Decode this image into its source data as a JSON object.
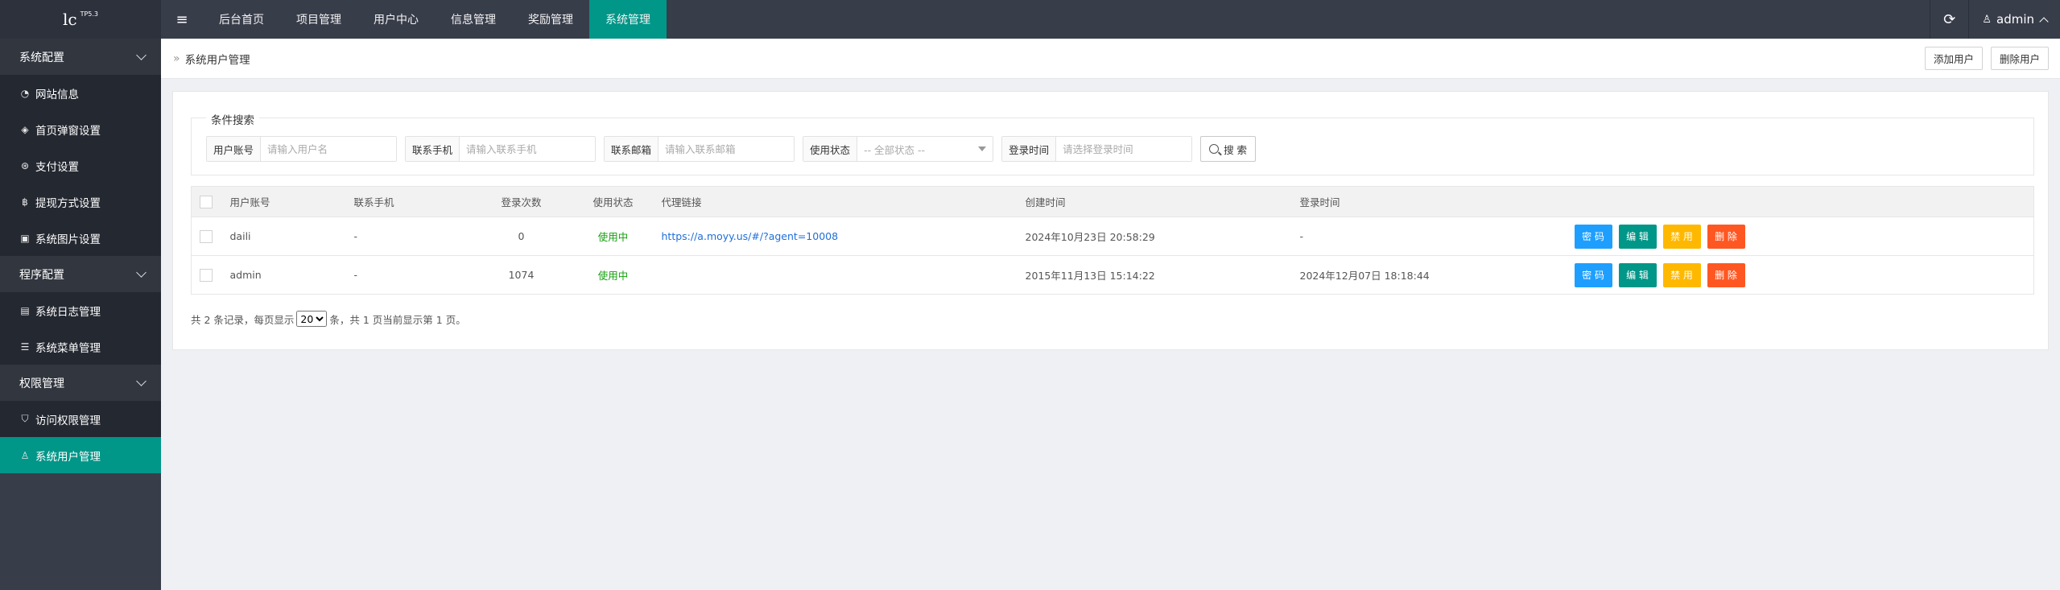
{
  "logo": {
    "text": "lc",
    "version": "TP5.3"
  },
  "sidebar": {
    "sections": [
      {
        "label": "系统配置",
        "items": [
          {
            "label": "网站信息",
            "icon": "gauge-icon"
          },
          {
            "label": "首页弹窗设置",
            "icon": "tag-icon"
          },
          {
            "label": "支付设置",
            "icon": "payment-icon"
          },
          {
            "label": "提现方式设置",
            "icon": "bitcoin-icon"
          },
          {
            "label": "系统图片设置",
            "icon": "image-icon"
          }
        ]
      },
      {
        "label": "程序配置",
        "items": [
          {
            "label": "系统日志管理",
            "icon": "log-icon"
          },
          {
            "label": "系统菜单管理",
            "icon": "menu-list-icon"
          }
        ]
      },
      {
        "label": "权限管理",
        "items": [
          {
            "label": "访问权限管理",
            "icon": "shield-icon"
          },
          {
            "label": "系统用户管理",
            "icon": "user-icon",
            "active": true
          }
        ]
      }
    ]
  },
  "topnav": {
    "items": [
      "后台首页",
      "项目管理",
      "用户中心",
      "信息管理",
      "奖励管理",
      "系统管理"
    ],
    "active": "系统管理",
    "user": "admin"
  },
  "breadcrumb": {
    "title": "系统用户管理",
    "add_label": "添加用户",
    "delete_label": "删除用户"
  },
  "search": {
    "legend": "条件搜索",
    "account_label": "用户账号",
    "account_placeholder": "请输入用户名",
    "phone_label": "联系手机",
    "phone_placeholder": "请输入联系手机",
    "email_label": "联系邮箱",
    "email_placeholder": "请输入联系邮箱",
    "status_label": "使用状态",
    "status_value": "-- 全部状态 --",
    "login_label": "登录时间",
    "login_placeholder": "请选择登录时间",
    "button": "搜 索"
  },
  "table": {
    "headers": [
      "用户账号",
      "联系手机",
      "登录次数",
      "使用状态",
      "代理链接",
      "创建时间",
      "登录时间"
    ],
    "rows": [
      {
        "account": "daili",
        "phone": "-",
        "logins": "0",
        "status": "使用中",
        "link": "https://a.moyy.us/#/?agent=10008",
        "created": "2024年10月23日 20:58:29",
        "login_time": "-"
      },
      {
        "account": "admin",
        "phone": "-",
        "logins": "1074",
        "status": "使用中",
        "link": "",
        "created": "2015年11月13日 15:14:22",
        "login_time": "2024年12月07日 18:18:44"
      }
    ],
    "ops": {
      "pwd": "密 码",
      "edit": "编 辑",
      "disable": "禁 用",
      "delete": "删 除"
    }
  },
  "pagination": {
    "prefix": "共 2 条记录，每页显示",
    "per_page": "20",
    "suffix": "条，共 1 页当前显示第 1 页。"
  },
  "colors": {
    "sidebar": "#383d4a",
    "accent": "#009688",
    "blue": "#1e9fff",
    "yellow": "#ffb800",
    "red": "#ff5722"
  }
}
